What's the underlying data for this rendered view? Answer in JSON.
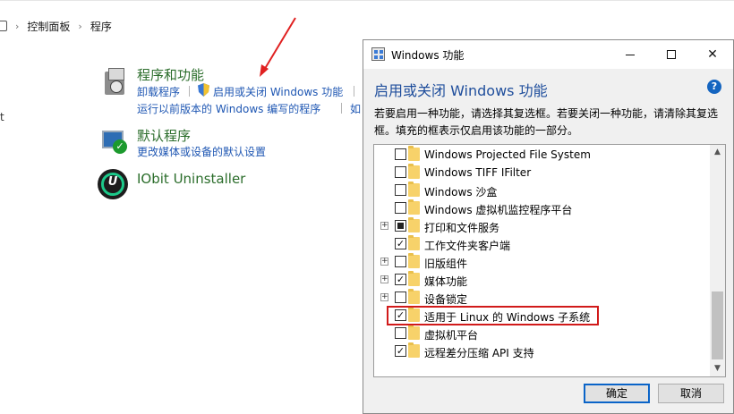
{
  "breadcrumb": {
    "item1": "控制面板",
    "item2": "程序"
  },
  "left_fragment": "t",
  "programs": {
    "title": "程序和功能",
    "links": [
      "卸载程序",
      "启用或关闭 Windows 功能",
      "运行以前版本的 Windows 编写的程序"
    ],
    "link_cut": "如"
  },
  "default_programs": {
    "title": "默认程序",
    "link": "更改媒体或设备的默认设置"
  },
  "iobit": {
    "title": "IObit Uninstaller",
    "icon_letter": "U"
  },
  "dialog": {
    "title": "Windows 功能",
    "heading": "启用或关闭 Windows 功能",
    "help": "?",
    "description": "若要启用一种功能，请选择其复选框。若要关闭一种功能，请清除其复选框。填充的框表示仅启用该功能的一部分。",
    "features": [
      {
        "label": "Windows Projected File System",
        "state": "unchecked",
        "expandable": false
      },
      {
        "label": "Windows TIFF IFilter",
        "state": "unchecked",
        "expandable": false
      },
      {
        "label": "Windows 沙盒",
        "state": "unchecked",
        "expandable": false
      },
      {
        "label": "Windows 虚拟机监控程序平台",
        "state": "unchecked",
        "expandable": false
      },
      {
        "label": "打印和文件服务",
        "state": "partial",
        "expandable": true
      },
      {
        "label": "工作文件夹客户端",
        "state": "checked",
        "expandable": false
      },
      {
        "label": "旧版组件",
        "state": "unchecked",
        "expandable": true
      },
      {
        "label": "媒体功能",
        "state": "checked",
        "expandable": true
      },
      {
        "label": "设备锁定",
        "state": "unchecked",
        "expandable": true
      },
      {
        "label": "适用于 Linux 的 Windows 子系统",
        "state": "checked",
        "expandable": false
      },
      {
        "label": "虚拟机平台",
        "state": "unchecked",
        "expandable": false
      },
      {
        "label": "远程差分压缩 API 支持",
        "state": "checked",
        "expandable": false
      }
    ],
    "ok_label": "确定",
    "cancel_label": "取消"
  },
  "colors": {
    "accent": "#0a64c8",
    "highlight": "#d11a1a",
    "link": "#1f57b3",
    "category_title": "#2b6d2b"
  }
}
